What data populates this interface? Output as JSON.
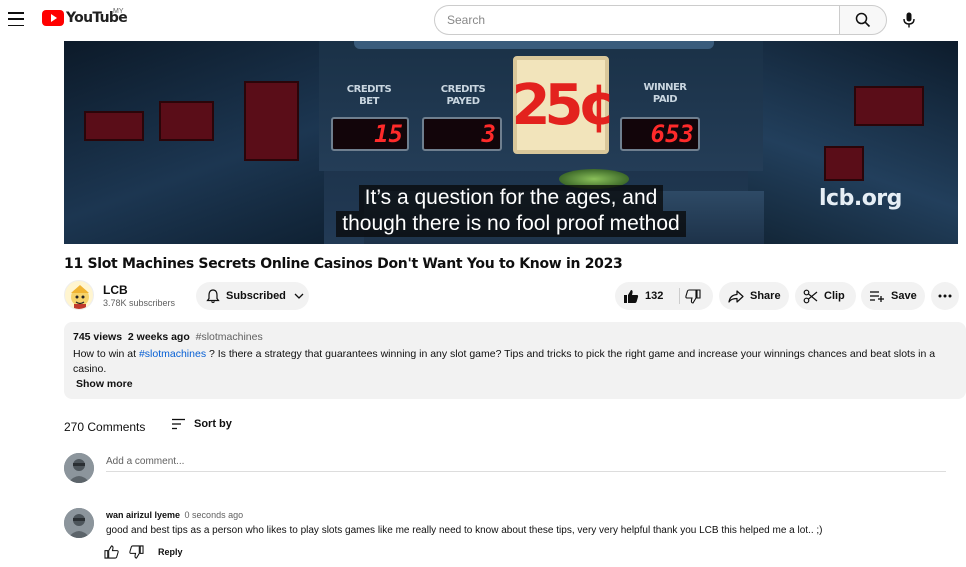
{
  "header": {
    "logo_text": "YouTube",
    "region": "MY",
    "search_placeholder": "Search",
    "icons": [
      "menu-icon",
      "search-icon",
      "mic-icon"
    ]
  },
  "video": {
    "labels": {
      "credits_bet": "CREDITS BET",
      "credits_payed": "CREDITS PAYED",
      "winner_paid": "WINNER PAID"
    },
    "displays": {
      "credits_bet": "15",
      "credits_payed": "3",
      "winner_paid": "653"
    },
    "price": "25¢",
    "subtitle_line1": "It’s a question for the ages, and",
    "subtitle_line2": "though there is no fool proof method",
    "watermark": "lcb.org"
  },
  "title": "11 Slot Machines Secrets Online Casinos Don't Want You to Know in 2023",
  "channel": {
    "name": "LCB",
    "subscribers": "3.78K subscribers",
    "subscribe_label": "Subscribed"
  },
  "actions": {
    "like_count": "132",
    "share_label": "Share",
    "clip_label": "Clip",
    "save_label": "Save"
  },
  "description": {
    "views": "745 views",
    "date": "2 weeks ago",
    "hashtag": "#slotmachines",
    "text_prefix": "How to win at ",
    "text_link": "#slotmachines",
    "text_rest": " ? Is there a strategy that guarantees winning in any slot game? Tips and tricks to pick the right game and increase your winnings chances and beat slots in a",
    "text_line2": "casino.",
    "show_more": "Show more"
  },
  "comments": {
    "count": "270 Comments",
    "sort_label": "Sort by",
    "add_placeholder": "Add a comment...",
    "items": [
      {
        "author": "wan airizul lyeme",
        "time": "0 seconds ago",
        "text": "good and best tips as a person who likes to play slots games like me really need to know about these tips, very very helpful thank you LCB this helped me a lot.. ;)",
        "reply_label": "Reply"
      }
    ]
  }
}
